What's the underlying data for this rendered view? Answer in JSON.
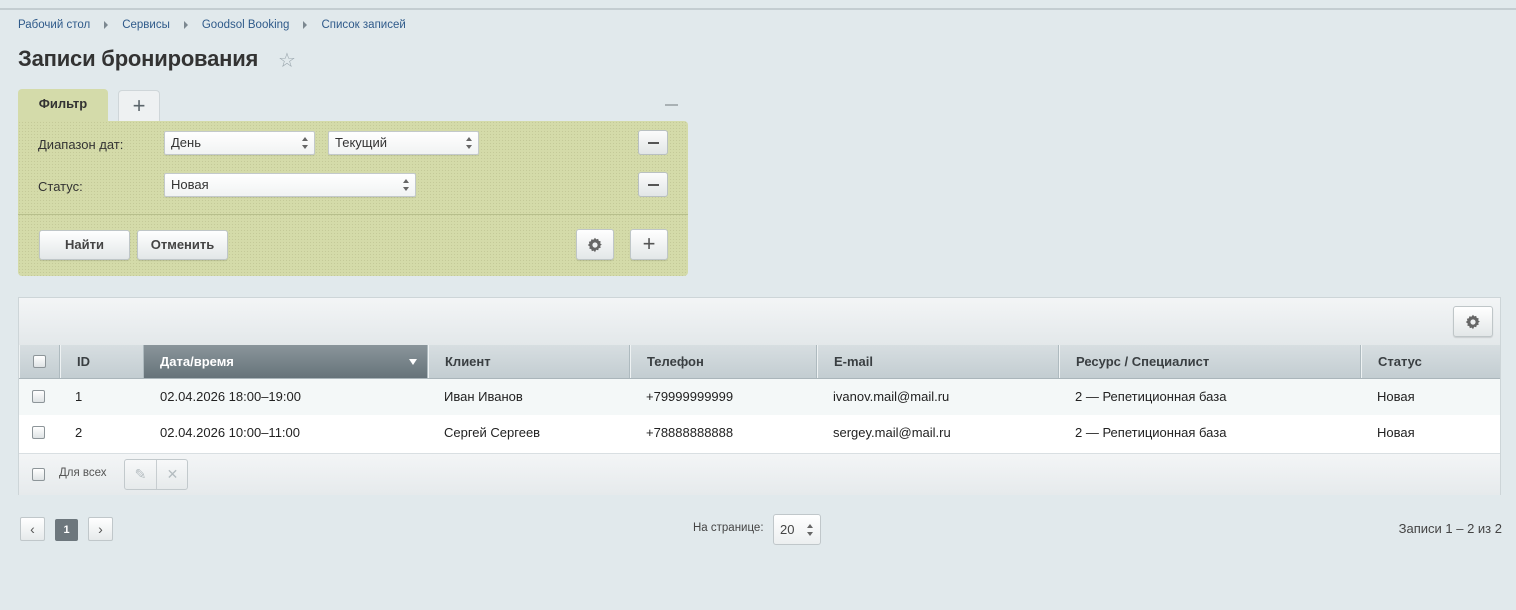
{
  "breadcrumb": [
    "Рабочий стол",
    "Сервисы",
    "Goodsol Booking",
    "Список записей"
  ],
  "page": {
    "title": "Записи бронирования"
  },
  "filter": {
    "tab_label": "Фильтр",
    "date_range_label": "Диапазон дат:",
    "date_range_period": "День",
    "date_range_value": "Текущий",
    "status_label": "Статус:",
    "status_value": "Новая",
    "find_label": "Найти",
    "cancel_label": "Отменить"
  },
  "grid": {
    "columns": [
      "ID",
      "Дата/время",
      "Клиент",
      "Телефон",
      "E-mail",
      "Ресурс / Специалист",
      "Статус"
    ],
    "rows": [
      {
        "id": "1",
        "datetime": "02.04.2026 18:00–19:00",
        "client": "Иван Иванов",
        "phone": "+79999999999",
        "email": "ivanov.mail@mail.ru",
        "resource": "2 — Репетиционная база",
        "status": "Новая"
      },
      {
        "id": "2",
        "datetime": "02.04.2026 10:00–11:00",
        "client": "Сергей Сергеев",
        "phone": "+78888888888",
        "email": "sergey.mail@mail.ru",
        "resource": "2 — Репетиционная база",
        "status": "Новая"
      }
    ],
    "for_all_label": "Для всех"
  },
  "pagination": {
    "current_page": "1",
    "per_page_label": "На странице:",
    "per_page_value": "20",
    "total": "Записи 1 – 2 из 2"
  },
  "icons": {
    "star": "star-icon",
    "gear": "gear-icon",
    "plus": "plus-icon",
    "minus": "minus-icon",
    "edit": "pencil-icon",
    "delete": "close-icon"
  }
}
